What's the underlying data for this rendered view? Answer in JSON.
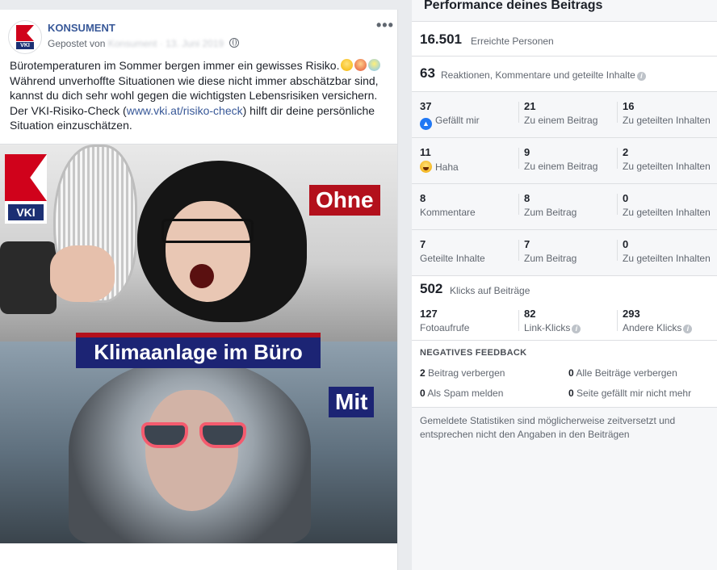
{
  "post": {
    "page_name": "KONSUMENT",
    "posted_by": "Gepostet von",
    "posted_by_blurred": "Konsument · 13. Juni 2019",
    "more": "•••",
    "text_line1": "Bürotemperaturen im Sommer bergen immer ein gewisses Risiko.",
    "text_line2": "Während unverhoffte Situationen wie diese nicht immer abschätzbar sind, kannst du dich sehr wohl gegen die wichtigsten Lebensrisiken versichern.",
    "text_line3_pre": "Der VKI-Risiko-Check (",
    "text_link": "www.vki.at/risiko-check",
    "text_line3_post": ") hilft dir deine persönliche Situation einzuschätzen.",
    "image": {
      "logo_text": "VKI",
      "label_top": "Ohne",
      "banner": "Klimaanlage im Büro",
      "label_bottom": "Mit"
    }
  },
  "panel": {
    "title": "Performance deines Beitrags",
    "reach": {
      "value": "16.501",
      "label": "Erreichte Personen"
    },
    "engagement": {
      "value": "63",
      "label": "Reaktionen, Kommentare und geteilte Inhalte"
    },
    "rows": [
      {
        "c1": {
          "n": "37",
          "l": "Gefällt mir"
        },
        "c2": {
          "n": "21",
          "l": "Zu einem Beitrag"
        },
        "c3": {
          "n": "16",
          "l": "Zu geteilten Inhalten"
        }
      },
      {
        "c1": {
          "n": "11",
          "l": "Haha"
        },
        "c2": {
          "n": "9",
          "l": "Zu einem Beitrag"
        },
        "c3": {
          "n": "2",
          "l": "Zu geteilten Inhalten"
        }
      },
      {
        "c1": {
          "n": "8",
          "l": "Kommentare"
        },
        "c2": {
          "n": "8",
          "l": "Zum Beitrag"
        },
        "c3": {
          "n": "0",
          "l": "Zu geteilten Inhalten"
        }
      },
      {
        "c1": {
          "n": "7",
          "l": "Geteilte Inhalte"
        },
        "c2": {
          "n": "7",
          "l": "Zum Beitrag"
        },
        "c3": {
          "n": "0",
          "l": "Zu geteilten Inhalten"
        }
      }
    ],
    "clicks": {
      "value": "502",
      "label": "Klicks auf Beiträge"
    },
    "click_cells": [
      {
        "n": "127",
        "l": "Fotoaufrufe"
      },
      {
        "n": "82",
        "l": "Link-Klicks"
      },
      {
        "n": "293",
        "l": "Andere Klicks"
      }
    ],
    "negative": {
      "title": "NEGATIVES FEEDBACK",
      "items": [
        {
          "n": "2",
          "l": "Beitrag verbergen"
        },
        {
          "n": "0",
          "l": "Alle Beiträge verbergen"
        },
        {
          "n": "0",
          "l": "Als Spam melden"
        },
        {
          "n": "0",
          "l": "Seite gefällt mir nicht mehr"
        }
      ]
    },
    "disclaimer": "Gemeldete Statistiken sind möglicherweise zeitversetzt und entsprechen nicht den Angaben in den Beiträgen",
    "info_glyph": "i"
  }
}
